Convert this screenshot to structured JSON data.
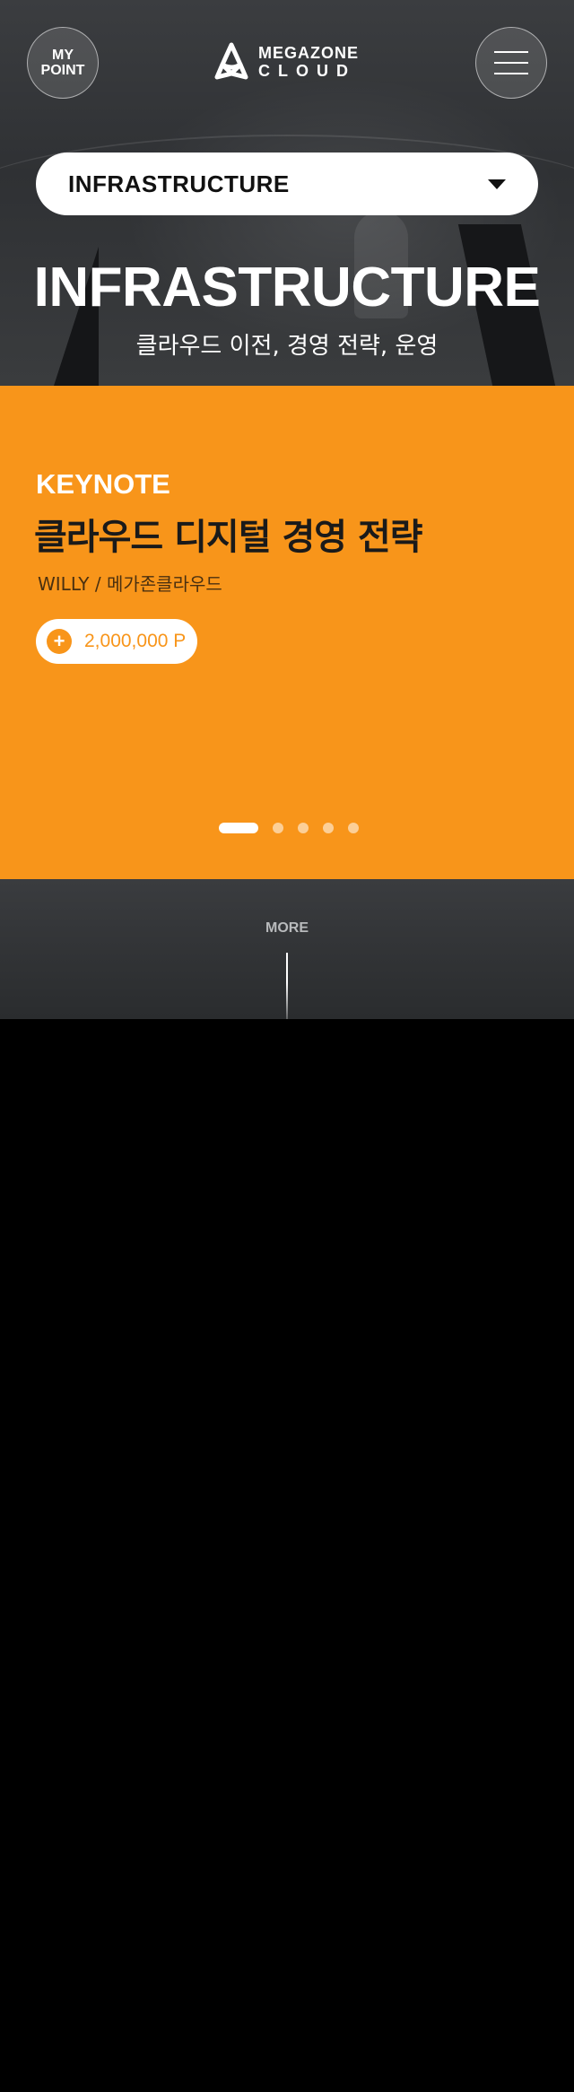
{
  "header": {
    "my_point_label": "MY\nPOINT",
    "logo_line1": "MEGAZONE",
    "logo_line2": "CLOUD",
    "menu_icon": "hamburger-icon"
  },
  "track_selector": {
    "selected": "INFRASTRUCTURE",
    "icon": "caret-down-icon"
  },
  "hero": {
    "title": "INFRASTRUCTURE",
    "subtitle": "클라우드 이전,  경영 전략, 운영"
  },
  "session": {
    "type": "KEYNOTE",
    "title": "클라우드 디지털 경영 전략",
    "speaker": "WILLY / 메가존클라우드",
    "points": "2,000,000 P",
    "plus_icon": "plus-icon"
  },
  "carousel": {
    "total": 5,
    "active_index": 0
  },
  "more": {
    "label": "MORE"
  },
  "colors": {
    "accent": "#f8951a",
    "dark": "#2f3134"
  }
}
